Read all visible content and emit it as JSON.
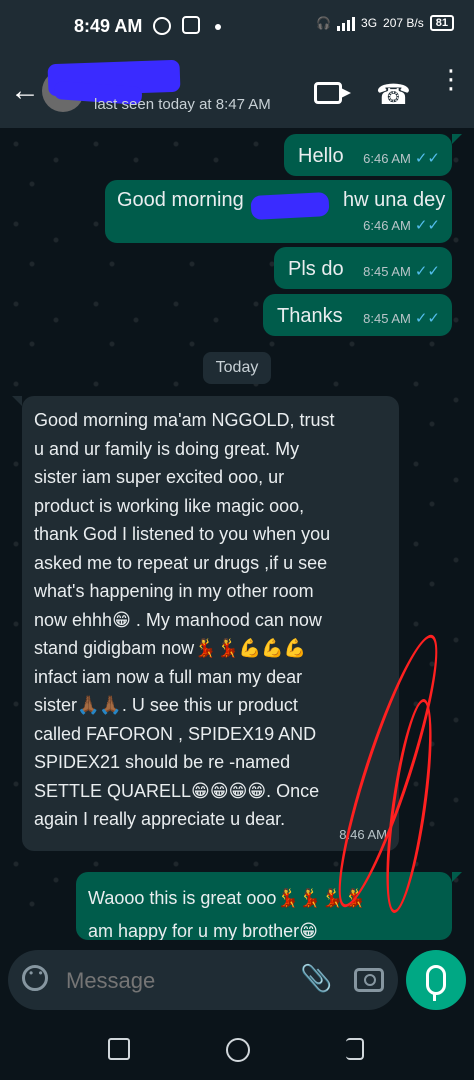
{
  "status_bar": {
    "time": "8:49 AM",
    "network_3g": "3G",
    "speed": "207",
    "speed_unit": "B/s",
    "battery": "81"
  },
  "app_bar": {
    "last_seen": "last seen today at 8:47 AM",
    "icons": [
      "back-arrow-icon",
      "video-call-icon",
      "voice-call-icon",
      "more-vert-icon"
    ]
  },
  "messages": [
    {
      "dir": "out",
      "text": "Hello",
      "time": "6:46 AM"
    },
    {
      "dir": "out",
      "text_left": "Good morning",
      "text_right": "hw una dey",
      "time": "6:46 AM"
    },
    {
      "dir": "out",
      "text": "Pls do",
      "time": "8:45 AM"
    },
    {
      "dir": "out",
      "text": "Thanks",
      "time": "8:45 AM"
    },
    {
      "dir": "in",
      "lines": [
        "Good morning ma'am NGGOLD, trust",
        "u and ur family is doing great. My",
        "sister iam super excited ooo, ur",
        "product is working like magic ooo,",
        "thank God I listened to you when you",
        "asked me to repeat ur drugs ,if u see",
        "what's happening in my other room",
        "now ehhh😁 . My manhood can now",
        "stand gidigbam now💃💃💪💪💪",
        "infact iam now a full man my dear",
        "sister🙏🏾🙏🏾. U see this ur product",
        "called FAFORON , SPIDEX19 AND",
        "SPIDEX21 should be re -named",
        "SETTLE QUARELL😁😁😁😁. Once",
        "again I really appreciate u dear."
      ],
      "time": "8:46 AM"
    },
    {
      "dir": "out",
      "lines": [
        "Waooo this is great ooo💃💃💃💃",
        "am happy for u my brother😁"
      ]
    }
  ],
  "date_chip": "Today",
  "composer": {
    "placeholder": "Message"
  },
  "colors": {
    "outgoing": "#005c4b",
    "incoming": "#202c33",
    "accent": "#00a884",
    "ticks": "#53bdeb"
  }
}
